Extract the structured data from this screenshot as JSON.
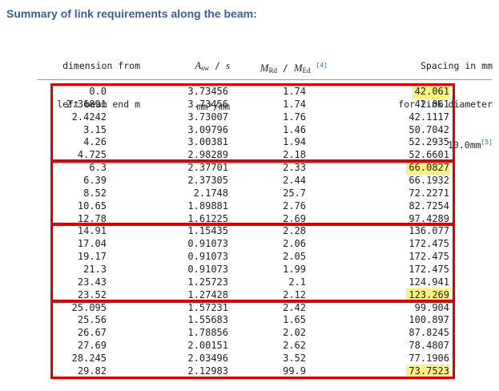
{
  "title": "Summary of link requirements along the beam:",
  "headers": {
    "col0_line1": "dimension from",
    "col0_line2": "left beam end m",
    "col1_asw": "A",
    "col1_sw": "sw",
    "col1_slash": " / ",
    "col1_s": "s",
    "col1_unit": "mm²/mm",
    "col2_m": "M",
    "col2_rd": "Rd",
    "col2_slash": " / ",
    "col2_m2": "M",
    "col2_ed": "Ed",
    "col2_ref": "[4]",
    "col3_line1": "Spacing in mm",
    "col3_line2": "for link diameter",
    "col3_line3": "10.0mm",
    "col3_ref": "[5]"
  },
  "rows": [
    {
      "d": "0.0",
      "asw": "3.73456",
      "ratio": "1.74",
      "spacing": "42.061",
      "highlight": true
    },
    {
      "d": "2.36891",
      "asw": "3.73456",
      "ratio": "1.74",
      "spacing": "42.061",
      "highlight": false
    },
    {
      "d": "2.4242",
      "asw": "3.73007",
      "ratio": "1.76",
      "spacing": "42.1117",
      "highlight": false
    },
    {
      "d": "3.15",
      "asw": "3.09796",
      "ratio": "1.46",
      "spacing": "50.7042",
      "highlight": false
    },
    {
      "d": "4.26",
      "asw": "3.00381",
      "ratio": "1.94",
      "spacing": "52.2935",
      "highlight": false
    },
    {
      "d": "4.725",
      "asw": "2.98289",
      "ratio": "2.18",
      "spacing": "52.6601",
      "highlight": false
    },
    {
      "d": "6.3",
      "asw": "2.37701",
      "ratio": "2.33",
      "spacing": "66.0827",
      "highlight": true
    },
    {
      "d": "6.39",
      "asw": "2.37305",
      "ratio": "2.44",
      "spacing": "66.1932",
      "highlight": false
    },
    {
      "d": "8.52",
      "asw": "2.1748",
      "ratio": "25.7",
      "spacing": "72.2271",
      "highlight": false
    },
    {
      "d": "10.65",
      "asw": "1.89881",
      "ratio": "2.76",
      "spacing": "82.7254",
      "highlight": false
    },
    {
      "d": "12.78",
      "asw": "1.61225",
      "ratio": "2.69",
      "spacing": "97.4289",
      "highlight": false
    },
    {
      "d": "14.91",
      "asw": "1.15435",
      "ratio": "2.28",
      "spacing": "136.077",
      "highlight": false
    },
    {
      "d": "17.04",
      "asw": "0.91073",
      "ratio": "2.06",
      "spacing": "172.475",
      "highlight": false
    },
    {
      "d": "19.17",
      "asw": "0.91073",
      "ratio": "2.05",
      "spacing": "172.475",
      "highlight": false
    },
    {
      "d": "21.3",
      "asw": "0.91073",
      "ratio": "1.99",
      "spacing": "172.475",
      "highlight": false
    },
    {
      "d": "23.43",
      "asw": "1.25723",
      "ratio": "2.1",
      "spacing": "124.941",
      "highlight": false
    },
    {
      "d": "23.52",
      "asw": "1.27428",
      "ratio": "2.12",
      "spacing": "123.269",
      "highlight": true
    },
    {
      "d": "25.095",
      "asw": "1.57231",
      "ratio": "2.42",
      "spacing": "99.904",
      "highlight": false
    },
    {
      "d": "25.56",
      "asw": "1.55683",
      "ratio": "1.65",
      "spacing": "100.897",
      "highlight": false
    },
    {
      "d": "26.67",
      "asw": "1.78856",
      "ratio": "2.02",
      "spacing": "87.8245",
      "highlight": false
    },
    {
      "d": "27.69",
      "asw": "2.00151",
      "ratio": "2.62",
      "spacing": "78.4807",
      "highlight": false
    },
    {
      "d": "28.245",
      "asw": "2.03496",
      "ratio": "3.52",
      "spacing": "77.1906",
      "highlight": false
    },
    {
      "d": "29.82",
      "asw": "2.12983",
      "ratio": "99.9",
      "spacing": "73.7523",
      "highlight": true
    }
  ],
  "group_boxes": [
    {
      "first_row": 0,
      "last_row": 5
    },
    {
      "first_row": 6,
      "last_row": 10
    },
    {
      "first_row": 11,
      "last_row": 16
    },
    {
      "first_row": 17,
      "last_row": 22
    }
  ],
  "colors": {
    "title": "#3a5f9e",
    "highlight": "#fbf27a",
    "box_border": "#e00000"
  }
}
